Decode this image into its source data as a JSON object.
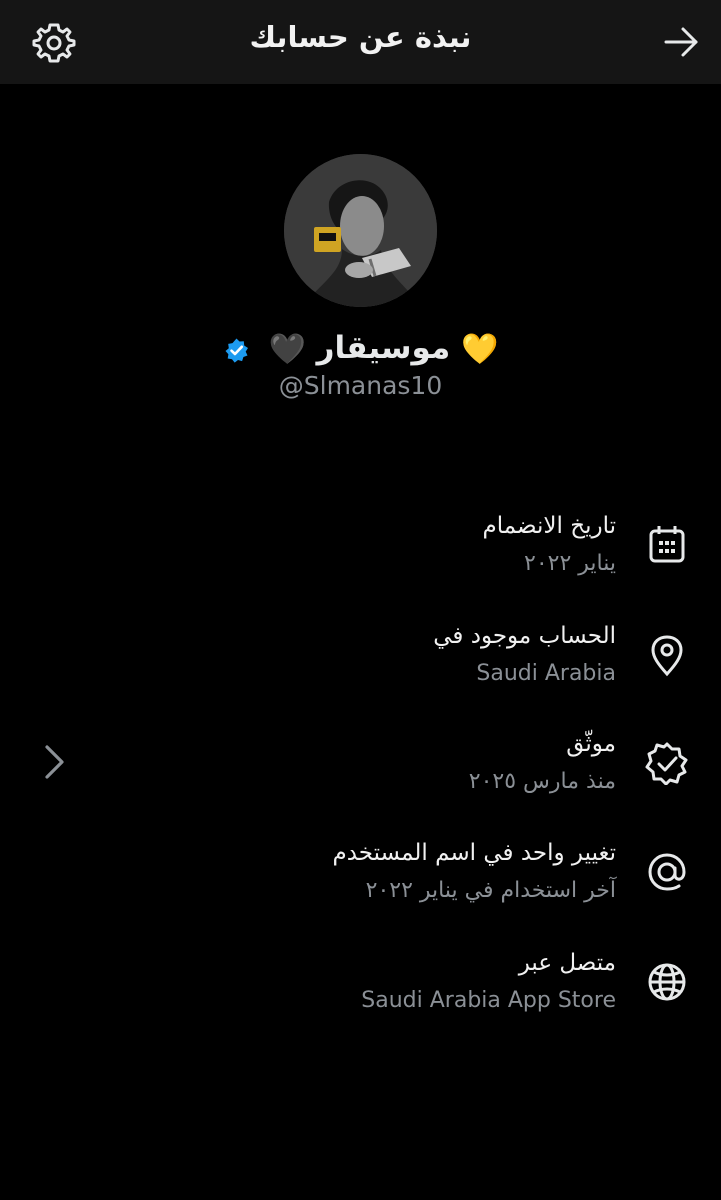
{
  "header": {
    "title": "نبذة عن حسابك",
    "settings_icon": "gear-icon",
    "back_icon": "arrow-right-icon"
  },
  "profile": {
    "name": "موسيقار",
    "emoji_left": "💛",
    "emoji_right": "🖤",
    "handle": "@Slmanas10",
    "verified_color": "#1d9bf0"
  },
  "details": [
    {
      "label": "تاريخ الانضمام",
      "value": "يناير ٢٠٢٢",
      "icon": "calendar-icon"
    },
    {
      "label": "الحساب موجود في",
      "value": "Saudi Arabia",
      "icon": "location-pin-icon"
    },
    {
      "label": "موثّق",
      "value": "منذ مارس ٢٠٢٥",
      "icon": "verified-badge-icon"
    },
    {
      "label": "تغيير واحد في اسم المستخدم",
      "value": "آخر استخدام في يناير ٢٠٢٢",
      "icon": "at-sign-icon"
    },
    {
      "label": "متصل عبر",
      "value": "Saudi Arabia App Store",
      "icon": "globe-icon"
    }
  ],
  "colors": {
    "background": "#000000",
    "header": "#151515",
    "primary_text": "#e7e9ea",
    "secondary_text": "#8b9096"
  }
}
